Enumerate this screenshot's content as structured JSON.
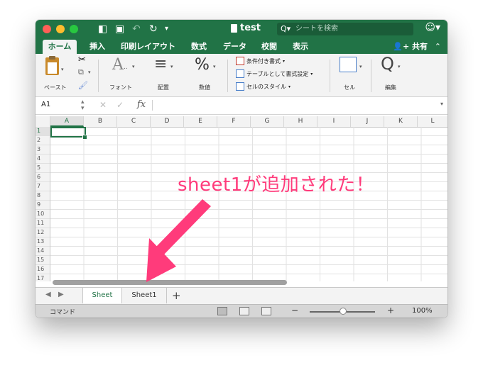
{
  "window": {
    "title": "test",
    "search_placeholder": "シートを検索"
  },
  "tabs": [
    "ホーム",
    "挿入",
    "印刷レイアウト",
    "数式",
    "データ",
    "校閲",
    "表示"
  ],
  "share_label": "共有",
  "ribbon": {
    "paste": "ペースト",
    "font": "フォント",
    "align": "配置",
    "number": "数値",
    "conditional_format": "条件付き書式",
    "format_as_table": "テーブルとして書式設定",
    "cell_styles": "セルのスタイル",
    "cells": "セル",
    "edit": "編集"
  },
  "formula_bar": {
    "name_box": "A1",
    "fx": "fx"
  },
  "columns": [
    "A",
    "B",
    "C",
    "D",
    "E",
    "F",
    "G",
    "H",
    "I",
    "J",
    "K",
    "L"
  ],
  "rows": [
    "1",
    "2",
    "3",
    "4",
    "5",
    "6",
    "7",
    "8",
    "9",
    "10",
    "11",
    "12",
    "13",
    "14",
    "15",
    "16",
    "17",
    "18"
  ],
  "sheets": [
    "Sheet",
    "Sheet1"
  ],
  "active_sheet": "Sheet",
  "status": {
    "mode": "コマンド",
    "zoom": "100%"
  },
  "annotation": "sheet1が追加された！",
  "colors": {
    "excel_green": "#217346",
    "annotation_pink": "#ff3b7b"
  }
}
